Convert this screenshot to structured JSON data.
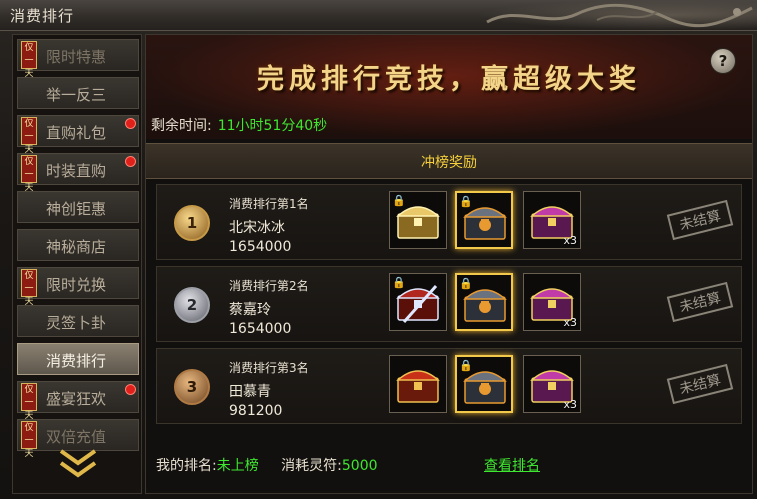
{
  "window": {
    "title": "消费排行"
  },
  "sidebar": {
    "tag_text": "仅一天",
    "items": [
      {
        "label": "限时特惠",
        "tag": true,
        "dot": false,
        "state": "dim"
      },
      {
        "label": "举一反三",
        "tag": false,
        "dot": false,
        "state": "normal"
      },
      {
        "label": "直购礼包",
        "tag": true,
        "dot": true,
        "state": "normal"
      },
      {
        "label": "时装直购",
        "tag": true,
        "dot": true,
        "state": "normal"
      },
      {
        "label": "神创钜惠",
        "tag": false,
        "dot": false,
        "state": "normal"
      },
      {
        "label": "神秘商店",
        "tag": false,
        "dot": false,
        "state": "normal"
      },
      {
        "label": "限时兑换",
        "tag": true,
        "dot": false,
        "state": "normal"
      },
      {
        "label": "灵签卜卦",
        "tag": false,
        "dot": false,
        "state": "normal"
      },
      {
        "label": "消费排行",
        "tag": false,
        "dot": false,
        "state": "active"
      },
      {
        "label": "盛宴狂欢",
        "tag": true,
        "dot": true,
        "state": "normal"
      },
      {
        "label": "双倍充值",
        "tag": true,
        "dot": false,
        "state": "dim"
      }
    ],
    "scroll_up_icon": "double-chevron-up-icon",
    "scroll_down_icon": "double-chevron-down-icon"
  },
  "banner": {
    "title": "完成排行竞技，赢超级大奖",
    "help_label": "?"
  },
  "countdown": {
    "label": "剩余时间:",
    "value": "11小时51分40秒"
  },
  "section": {
    "title": "冲榜奖励"
  },
  "ranks": [
    {
      "medal": "1",
      "medal_style": "gold",
      "title": "消费排行第1名",
      "name": "北宋冰冰",
      "score": "1654000",
      "rewards": [
        {
          "icon": "golden-treasure-chest-icon",
          "locked": true,
          "glow": false,
          "qty": ""
        },
        {
          "icon": "ornate-chest-icon",
          "locked": true,
          "glow": true,
          "qty": ""
        },
        {
          "icon": "purple-chest-icon",
          "locked": false,
          "glow": false,
          "qty": "x3"
        }
      ],
      "status": "未结算"
    },
    {
      "medal": "2",
      "medal_style": "silver",
      "title": "消费排行第2名",
      "name": "蔡嘉玲",
      "score": "1654000",
      "rewards": [
        {
          "icon": "red-chest-with-sword-icon",
          "locked": true,
          "glow": false,
          "qty": ""
        },
        {
          "icon": "ornate-chest-icon",
          "locked": true,
          "glow": true,
          "qty": ""
        },
        {
          "icon": "purple-chest-icon",
          "locked": false,
          "glow": false,
          "qty": "x3"
        }
      ],
      "status": "未结算"
    },
    {
      "medal": "3",
      "medal_style": "bronze",
      "title": "消费排行第3名",
      "name": "田慕青",
      "score": "981200",
      "rewards": [
        {
          "icon": "red-gold-chest-icon",
          "locked": false,
          "glow": false,
          "qty": ""
        },
        {
          "icon": "ornate-chest-icon",
          "locked": true,
          "glow": true,
          "qty": ""
        },
        {
          "icon": "purple-chest-icon",
          "locked": false,
          "glow": false,
          "qty": "x3"
        }
      ],
      "status": "未结算"
    }
  ],
  "footer": {
    "my_rank_label": "我的排名:",
    "my_rank_value": "未上榜",
    "spent_label": "消耗灵符:",
    "spent_value": "5000",
    "view_rank_link": "查看排名"
  },
  "colors": {
    "accent_green": "#3ee830",
    "gold_text": "#f3d58a",
    "section_yellow": "#f5d03a",
    "tag_red": "#8c1c12"
  }
}
